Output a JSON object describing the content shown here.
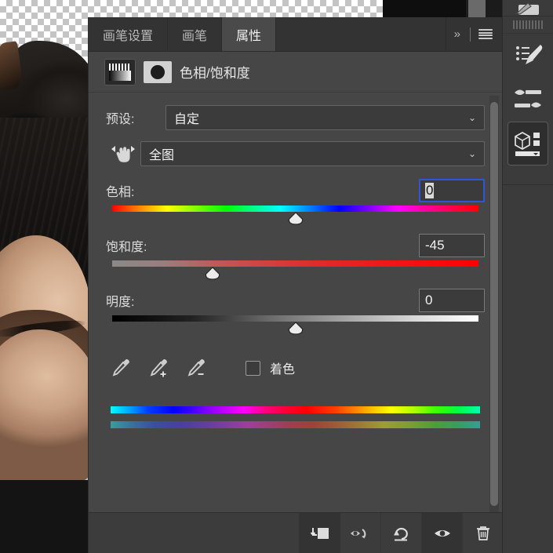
{
  "app": {
    "panel_tabs": [
      {
        "label": "画笔设置",
        "active": false
      },
      {
        "label": "画笔",
        "active": false
      },
      {
        "label": "属性",
        "active": true
      }
    ],
    "tab_actions": {
      "expand_label": "»",
      "menu_icon": "hamburger-menu-icon"
    }
  },
  "properties": {
    "title": "色相/饱和度",
    "adjustment_thumb_icon": "hue-saturation-adjustment-icon",
    "layer_mask_thumb_icon": "layer-mask-thumbnail-icon",
    "preset": {
      "label": "预设:",
      "value": "自定",
      "caret": "⌄"
    },
    "channel": {
      "targeted_adjustment_icon": "targeted-adjustment-hand-icon",
      "value": "全图",
      "caret": "⌄"
    },
    "sliders": [
      {
        "name": "hue",
        "label": "色相:",
        "value": "0",
        "value_number": 0,
        "min": -180,
        "max": 180,
        "thumb_percent": 50,
        "track": "hue-spectrum",
        "focused": true,
        "selected_text": true
      },
      {
        "name": "saturation",
        "label": "饱和度:",
        "value": "-45",
        "value_number": -45,
        "min": -100,
        "max": 100,
        "thumb_percent": 27.5,
        "track": "saturation-gradient",
        "focused": false,
        "selected_text": false
      },
      {
        "name": "lightness",
        "label": "明度:",
        "value": "0",
        "value_number": 0,
        "min": -100,
        "max": 100,
        "thumb_percent": 50,
        "track": "lightness-gradient",
        "focused": false,
        "selected_text": false
      }
    ],
    "eyedroppers": [
      {
        "name": "eyedropper-sample-icon",
        "mode": "sample"
      },
      {
        "name": "eyedropper-add-icon",
        "mode": "add"
      },
      {
        "name": "eyedropper-subtract-icon",
        "mode": "subtract"
      }
    ],
    "colorize": {
      "label": "着色",
      "checked": false
    },
    "hue_bars": {
      "top_name": "hue-range-bar-original",
      "bottom_name": "hue-range-bar-adjusted"
    },
    "footer_buttons": [
      {
        "name": "clip-to-layer-button",
        "icon": "clip-to-layer-icon",
        "selected": true
      },
      {
        "name": "view-previous-state-button",
        "icon": "eye-with-arrow-icon",
        "selected": false
      },
      {
        "name": "reset-button",
        "icon": "reset-arrow-icon",
        "selected": false
      },
      {
        "name": "toggle-layer-visibility-button",
        "icon": "eye-icon",
        "selected": true
      },
      {
        "name": "delete-layer-button",
        "icon": "trash-icon",
        "selected": false
      }
    ]
  },
  "dock": {
    "items": [
      {
        "name": "brush-tip-icon",
        "label": ""
      },
      {
        "name": "brush-settings-icon",
        "label": ""
      },
      {
        "name": "brush-presets-icon",
        "label": ""
      },
      {
        "name": "properties-cube-icon",
        "label": "",
        "active": true
      }
    ]
  },
  "canvas": {
    "transparency_checker": "transparency-checkerboard",
    "image_name": "document-photo-layer"
  },
  "colors": {
    "panel_bg": "#464646",
    "tabbar_bg": "#333333",
    "active_tab_bg": "#4a4a4a",
    "field_bg": "#3b3b3b",
    "focus_border": "#2b57d8",
    "text": "#e6e6e6",
    "dock_bg": "#3b3b3b",
    "footer_bg": "#3c3c3c"
  }
}
